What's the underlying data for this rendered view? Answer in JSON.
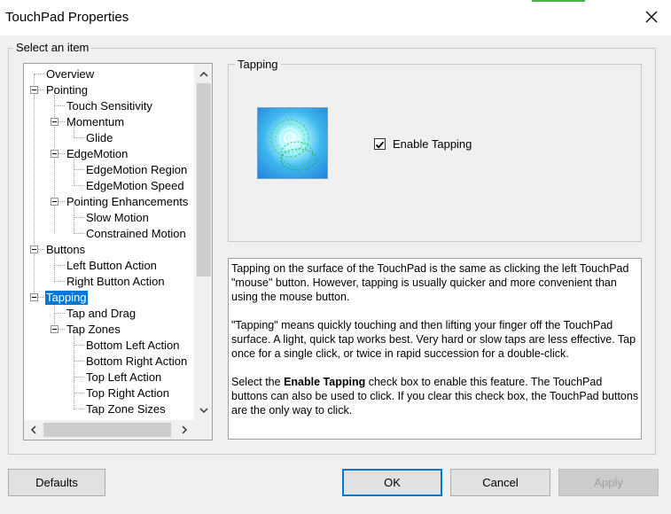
{
  "window": {
    "title": "TouchPad Properties",
    "close_icon": "close-icon"
  },
  "group": {
    "label": "Select an item"
  },
  "tree": {
    "items": [
      {
        "label": "Overview",
        "level": 0,
        "expandable": false
      },
      {
        "label": "Pointing",
        "level": 0,
        "expandable": true
      },
      {
        "label": "Touch Sensitivity",
        "level": 1,
        "expandable": false
      },
      {
        "label": "Momentum",
        "level": 1,
        "expandable": true
      },
      {
        "label": "Glide",
        "level": 2,
        "expandable": false
      },
      {
        "label": "EdgeMotion",
        "level": 1,
        "expandable": true
      },
      {
        "label": "EdgeMotion Region",
        "level": 2,
        "expandable": false
      },
      {
        "label": "EdgeMotion Speed",
        "level": 2,
        "expandable": false
      },
      {
        "label": "Pointing Enhancements",
        "level": 1,
        "expandable": true
      },
      {
        "label": "Slow Motion",
        "level": 2,
        "expandable": false
      },
      {
        "label": "Constrained Motion",
        "level": 2,
        "expandable": false
      },
      {
        "label": "Buttons",
        "level": 0,
        "expandable": true
      },
      {
        "label": "Left Button Action",
        "level": 1,
        "expandable": false
      },
      {
        "label": "Right Button Action",
        "level": 1,
        "expandable": false
      },
      {
        "label": "Tapping",
        "level": 0,
        "expandable": true,
        "selected": true
      },
      {
        "label": "Tap and Drag",
        "level": 1,
        "expandable": false
      },
      {
        "label": "Tap Zones",
        "level": 1,
        "expandable": true
      },
      {
        "label": "Bottom Left Action",
        "level": 2,
        "expandable": false
      },
      {
        "label": "Bottom Right Action",
        "level": 2,
        "expandable": false
      },
      {
        "label": "Top Left Action",
        "level": 2,
        "expandable": false
      },
      {
        "label": "Top Right Action",
        "level": 2,
        "expandable": false
      },
      {
        "label": "Tap Zone Sizes",
        "level": 2,
        "expandable": false
      }
    ]
  },
  "tapping": {
    "group_label": "Tapping",
    "picture_icon": "touchpad-tap-icon",
    "checkbox_label": "Enable Tapping",
    "checked": true
  },
  "description": {
    "p1": "Tapping on the surface of the TouchPad is the same as clicking the left TouchPad \"mouse\" button. However, tapping is usually quicker and more convenient than using the mouse button.",
    "p2": "\"Tapping\" means quickly touching and then lifting your finger off the TouchPad surface. A light, quick tap works best. Very hard or slow taps are less effective. Tap once for a single click, or twice in rapid succession for a double-click.",
    "p3_prefix": "Select the ",
    "p3_bold": "Enable Tapping",
    "p3_suffix": " check box to enable this feature. The TouchPad buttons can also be used to click. If you clear this check box, the TouchPad buttons are the only way to click."
  },
  "buttons": {
    "defaults": "Defaults",
    "ok": "OK",
    "cancel": "Cancel",
    "apply": "Apply"
  },
  "colors": {
    "selection": "#0078d7",
    "window_bg": "#f0f0f0"
  }
}
